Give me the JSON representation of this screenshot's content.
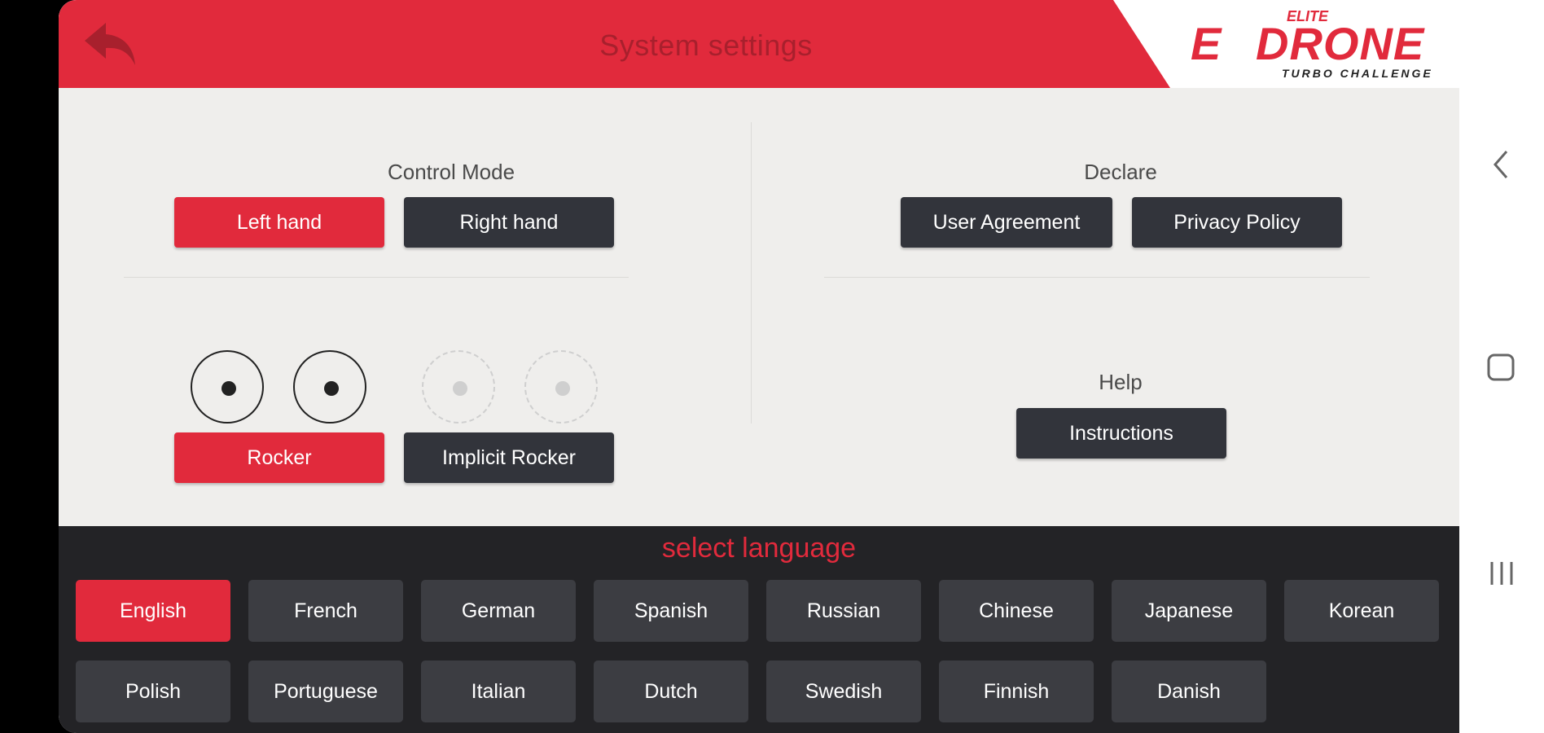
{
  "header": {
    "title": "System settings",
    "back_icon": "back-arrow-icon",
    "logo": {
      "top": "ELITE",
      "main": "DRONE",
      "sub": "TURBO CHALLENGE"
    }
  },
  "control_mode": {
    "label": "Control Mode",
    "options": [
      "Left hand",
      "Right hand"
    ],
    "selected": "Left hand"
  },
  "declare": {
    "label": "Declare",
    "buttons": [
      "User Agreement",
      "Privacy Policy"
    ]
  },
  "rocker": {
    "options": [
      "Rocker",
      "Implicit Rocker"
    ],
    "selected": "Rocker"
  },
  "help": {
    "label": "Help",
    "button": "Instructions"
  },
  "language": {
    "title": "select language",
    "options": [
      "English",
      "French",
      "German",
      "Spanish",
      "Russian",
      "Chinese",
      "Japanese",
      "Korean",
      "Polish",
      "Portuguese",
      "Italian",
      "Dutch",
      "Swedish",
      "Finnish",
      "Danish"
    ],
    "selected": "English"
  },
  "colors": {
    "accent": "#e12a3c",
    "dark_button": "#32343b",
    "panel": "#232326",
    "background": "#efeeec"
  },
  "system_nav": {
    "icons": [
      "nav-back-icon",
      "nav-home-icon",
      "nav-recents-icon"
    ]
  }
}
